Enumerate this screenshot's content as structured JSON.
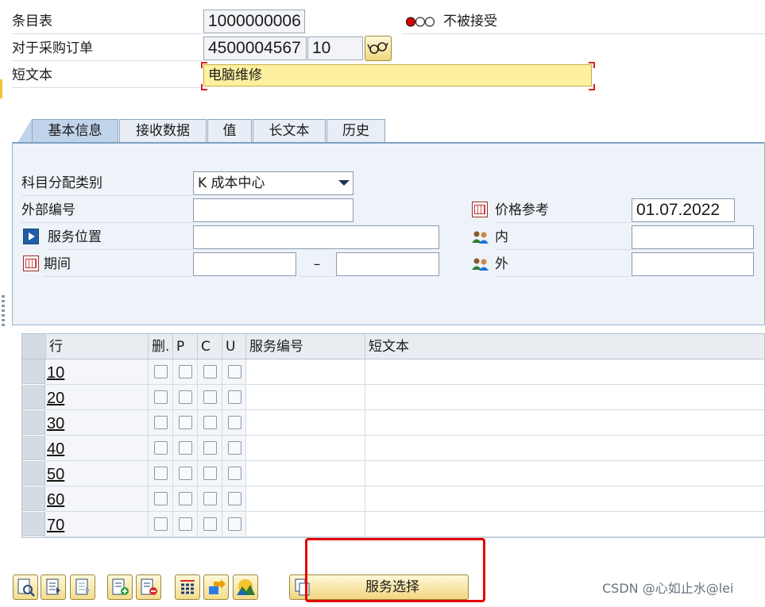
{
  "header": {
    "item_list_label": "条目表",
    "item_list_value": "1000000006",
    "status_text": "不被接受",
    "po_label": "对于采购订单",
    "po_number": "4500004567",
    "po_item": "10",
    "short_text_label": "短文本",
    "short_text_value": "电脑维修"
  },
  "tabs": [
    {
      "label": "基本信息",
      "active": true
    },
    {
      "label": "接收数据",
      "active": false
    },
    {
      "label": "值",
      "active": false
    },
    {
      "label": "长文本",
      "active": false
    },
    {
      "label": "历史",
      "active": false
    }
  ],
  "basic": {
    "acct_assign_label": "科目分配类别",
    "acct_assign_value": "K 成本中心",
    "ext_number_label": "外部编号",
    "ext_number_value": "",
    "service_loc_label": "服务位置",
    "service_loc_value": "",
    "period_label": "期间",
    "period_from": "",
    "period_dash": "–",
    "period_to": "",
    "price_ref_label": "价格参考",
    "price_ref_value": "01.07.2022",
    "internal_label": "内",
    "internal_value": "",
    "external_label": "外",
    "external_value": ""
  },
  "table": {
    "headers": [
      "行",
      "删.",
      "P",
      "C",
      "U",
      "服务编号",
      "短文本"
    ],
    "rows": [
      {
        "line": "10"
      },
      {
        "line": "20"
      },
      {
        "line": "30"
      },
      {
        "line": "40"
      },
      {
        "line": "50"
      },
      {
        "line": "60"
      },
      {
        "line": "70"
      }
    ]
  },
  "toolbar": {
    "icons": [
      "detail-icon",
      "select-all-icon",
      "deselect-icon",
      "insert-row-icon",
      "delete-row-icon",
      "calculator-icon",
      "move-icon",
      "chart-icon"
    ],
    "service_select_label": "服务选择"
  },
  "watermark": "CSDN @心如止水@lei",
  "colors": {
    "required_field": "#fdf0a0",
    "panel_bg": "#eef3f9",
    "button_gradient_top": "#fff8d8",
    "button_gradient_bottom": "#f1d67e",
    "highlight_box": "#e60000",
    "status_red": "#e00000"
  }
}
